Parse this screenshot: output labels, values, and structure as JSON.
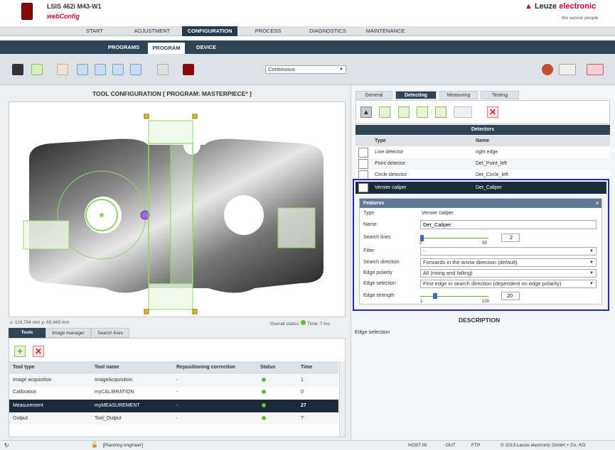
{
  "header": {
    "device": "LSIS 462i M43-W1",
    "app": "webConfig",
    "brand": "Leuze electronic",
    "brand_prefix": "Leuze",
    "brand_suffix": "electronic",
    "tagline": "the sensor people"
  },
  "nav": [
    "START",
    "ADJUSTMENT",
    "CONFIGURATION",
    "PROCESS",
    "DIAGNOSTICS",
    "MAINTENANCE"
  ],
  "subnav": [
    "PROGRAMS",
    "PROGRAM",
    "DEVICE"
  ],
  "toolbar": {
    "mode": "Continuous"
  },
  "left": {
    "title_prefix": "TOOL CONFIGURATION   [ PROGRAM: MASTERPIECE",
    "title_star": "*",
    "title_suffix": " ]",
    "coords": "x: 119,794 mm y: 69,465 mm",
    "overall": "Overall status:",
    "time": "Time: ? ms"
  },
  "left_tabs": [
    "Tools",
    "Image manager",
    "Search lines"
  ],
  "tools": {
    "headers": [
      "Tool type",
      "Tool name",
      "Repositioning correction",
      "Status",
      "Time"
    ],
    "rows": [
      [
        "Image acquisition",
        "ImageAcquisition",
        "-",
        "",
        "1"
      ],
      [
        "Calibration",
        "myCALIBRATION",
        "-",
        "",
        "0"
      ],
      [
        "Measurement",
        "myMEASUREMENT",
        "-",
        "",
        "27"
      ],
      [
        "Output",
        "Tool_Output",
        "-",
        "",
        "?"
      ]
    ]
  },
  "right_tabs": [
    "General",
    "Detecting",
    "Measuring",
    "Testing"
  ],
  "detectors": {
    "title": "Detectors",
    "headers": [
      "Type",
      "Name"
    ],
    "rows": [
      [
        "Line detector",
        "right edge"
      ],
      [
        "Point detector",
        "Det_Point_left"
      ],
      [
        "Circle detector",
        "Det_Circle_left"
      ],
      [
        "Vernier caliper",
        "Det_Caliper"
      ]
    ]
  },
  "features": {
    "title": "Features",
    "labels": [
      "Type",
      "Name",
      "Search lines",
      "Filter",
      "Search direction",
      "Edge polarity",
      "Edge selection",
      "Edge strength"
    ],
    "type": "Vernier caliper",
    "name": "Det_Caliper",
    "search_lines_min": "2",
    "search_lines_max": "99",
    "search_lines_val": "2",
    "filter": "-",
    "direction": "Forwards in the arrow direction (default)",
    "polarity": "All (rising and falling)",
    "selection": "First edge in search direction (dependent on edge polarity)",
    "strength_min": "1",
    "strength_max": "100",
    "strength_val": "20"
  },
  "description": {
    "title": "DESCRIPTION",
    "text": "Edge selection"
  },
  "status": {
    "host": "HOST IN",
    "out": "OUT",
    "ftp": "FTP",
    "user": "[Planning engineer]",
    "copyright": "© 2013 Leuze electronic GmbH + Co. KG"
  },
  "colors": {
    "accent": "#cc0033",
    "navy": "#2e4457",
    "dark_row": "#1c2b3a",
    "highlight": "#1a2fb5",
    "green": "#8fd860"
  }
}
